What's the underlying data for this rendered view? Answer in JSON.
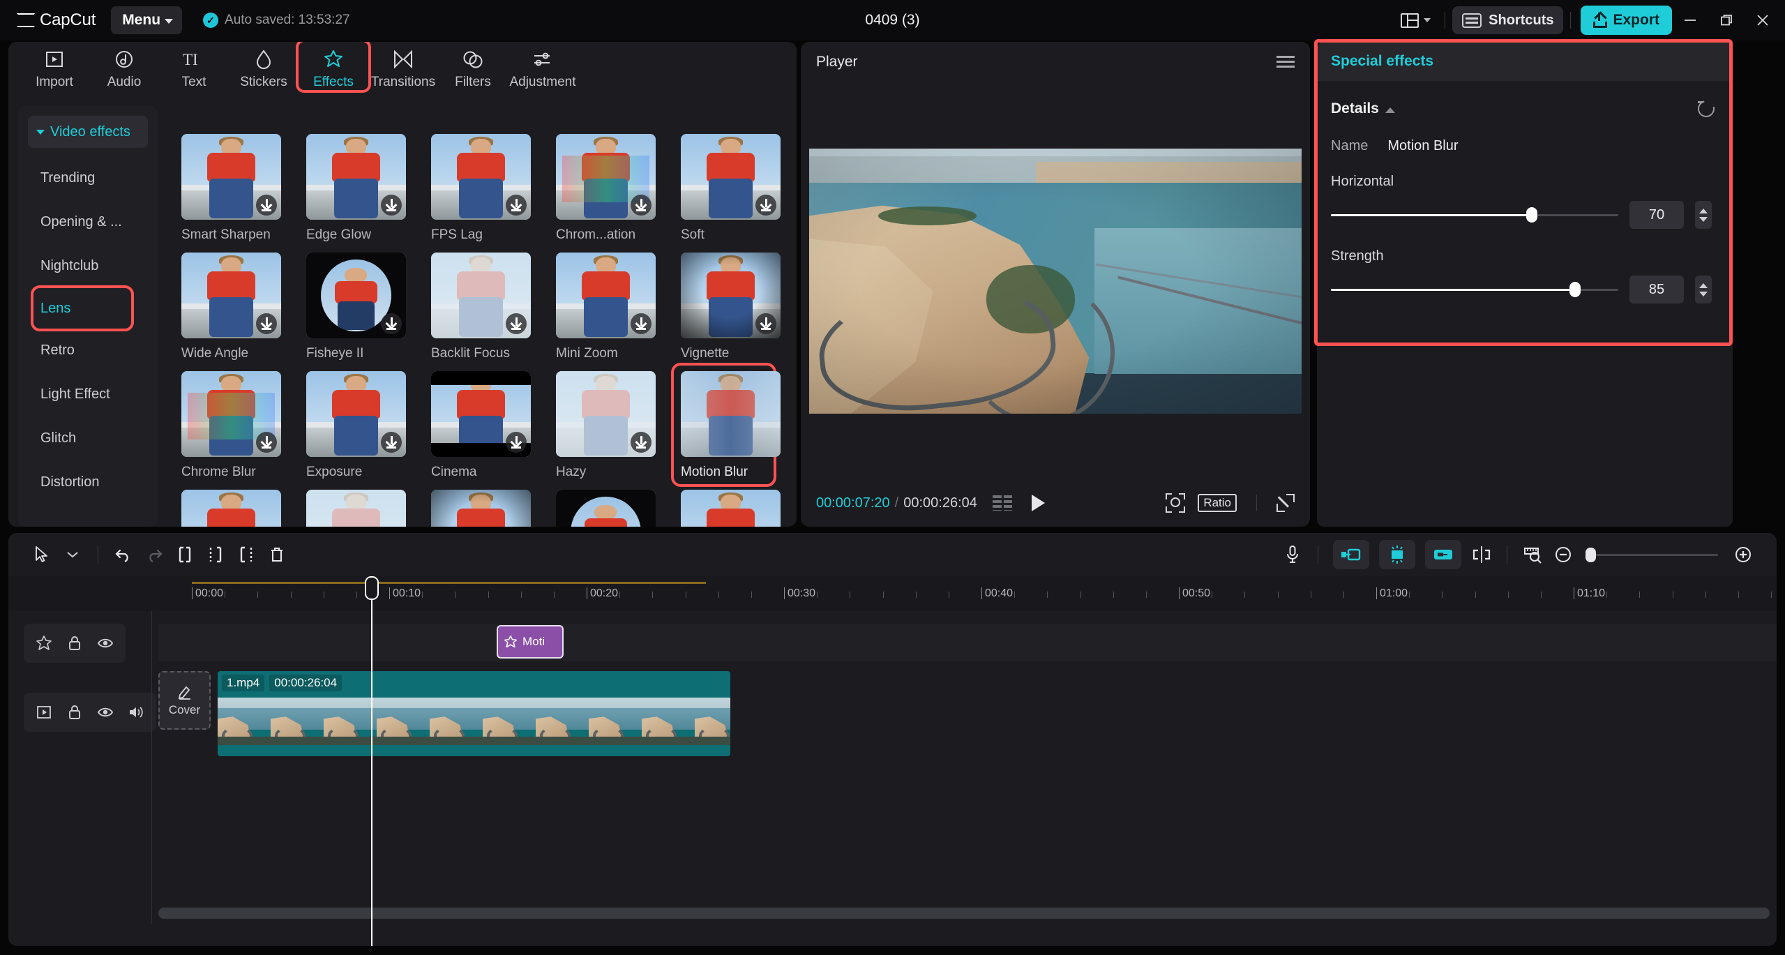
{
  "topbar": {
    "brand": "CapCut",
    "menu_label": "Menu",
    "autosave_text": "Auto saved: 13:53:27",
    "check_glyph": "✓",
    "project_title": "0409 (3)",
    "shortcuts_label": "Shortcuts",
    "export_label": "Export",
    "window_minimize": "minimize",
    "window_restore": "restore",
    "window_close": "close"
  },
  "tabs": [
    {
      "label": "Import",
      "icon": "import-icon",
      "active": false
    },
    {
      "label": "Audio",
      "icon": "audio-icon",
      "active": false
    },
    {
      "label": "Text",
      "icon": "text-icon",
      "active": false
    },
    {
      "label": "Stickers",
      "icon": "stickers-icon",
      "active": false
    },
    {
      "label": "Effects",
      "icon": "effects-icon",
      "active": true
    },
    {
      "label": "Transitions",
      "icon": "transitions-icon",
      "active": false
    },
    {
      "label": "Filters",
      "icon": "filters-icon",
      "active": false
    },
    {
      "label": "Adjustment",
      "icon": "adjustment-icon",
      "active": false
    }
  ],
  "categories": {
    "header": "Video effects",
    "items": [
      {
        "label": "Trending",
        "selected": false
      },
      {
        "label": "Opening & ...",
        "selected": false
      },
      {
        "label": "Nightclub",
        "selected": false
      },
      {
        "label": "Lens",
        "selected": true
      },
      {
        "label": "Retro",
        "selected": false
      },
      {
        "label": "Light Effect",
        "selected": false
      },
      {
        "label": "Glitch",
        "selected": false
      },
      {
        "label": "Distortion",
        "selected": false
      }
    ]
  },
  "effects_grid": {
    "rows": [
      [
        {
          "label": "Smart Sharpen",
          "downloadable": true,
          "selected": false
        },
        {
          "label": "Edge Glow",
          "downloadable": true,
          "selected": false
        },
        {
          "label": "FPS Lag",
          "downloadable": true,
          "selected": false
        },
        {
          "label": "Chrom...ation",
          "downloadable": true,
          "selected": false
        },
        {
          "label": "Soft",
          "downloadable": true,
          "selected": false
        }
      ],
      [
        {
          "label": "Wide Angle",
          "downloadable": true,
          "selected": false
        },
        {
          "label": "Fisheye II",
          "downloadable": true,
          "selected": false
        },
        {
          "label": "Backlit Focus",
          "downloadable": true,
          "selected": false
        },
        {
          "label": "Mini Zoom",
          "downloadable": true,
          "selected": false
        },
        {
          "label": "Vignette",
          "downloadable": true,
          "selected": false
        }
      ],
      [
        {
          "label": "Chrome Blur",
          "downloadable": true,
          "selected": false
        },
        {
          "label": "Exposure",
          "downloadable": true,
          "selected": false
        },
        {
          "label": "Cinema",
          "downloadable": true,
          "selected": false
        },
        {
          "label": "Hazy",
          "downloadable": true,
          "selected": false
        },
        {
          "label": "Motion Blur",
          "downloadable": false,
          "selected": true
        }
      ]
    ]
  },
  "player": {
    "title": "Player",
    "current_time": "00:00:07:20",
    "separator": "/",
    "total_time": "00:00:26:04",
    "ratio_label": "Ratio"
  },
  "right_panel": {
    "title": "Special effects",
    "details_label": "Details",
    "name_key": "Name",
    "name_value": "Motion Blur",
    "params": [
      {
        "label": "Horizontal",
        "value": "70",
        "percent": 70
      },
      {
        "label": "Strength",
        "value": "85",
        "percent": 85
      }
    ]
  },
  "timeline": {
    "ruler_labels": [
      "00:00",
      "00:10",
      "00:20",
      "00:30",
      "00:40",
      "00:50",
      "01:00",
      "01:10"
    ],
    "effect_clip_label": "Moti",
    "cover_label": "Cover",
    "video_clip_name": "1.mp4",
    "video_clip_duration": "00:00:26:04"
  },
  "colors": {
    "accent": "#1fcdd8",
    "highlight_ring": "#ff5252",
    "effect_clip": "#8b4fa8",
    "video_clip": "#0d6e73",
    "panel_bg": "#1c1c20"
  }
}
